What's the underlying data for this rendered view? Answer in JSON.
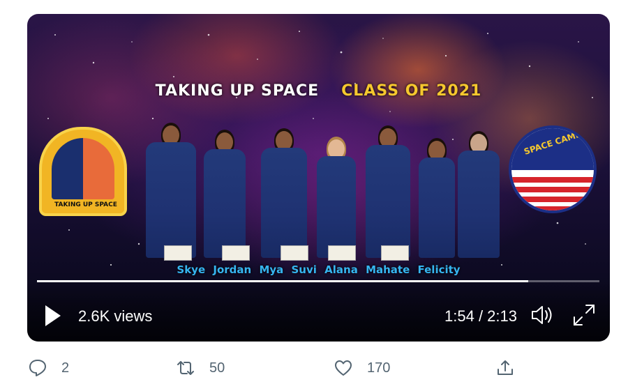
{
  "video": {
    "title_part1": "TAKING UP SPACE",
    "title_part2": "CLASS OF 2021",
    "patch_left_label": "TAKING UP SPACE",
    "patch_right_label": "SPACE CAMP",
    "names": [
      "Skye",
      "Jordan",
      "Mya",
      "Suvi",
      "Alana",
      "Mahate",
      "Felicity"
    ],
    "progress": 0.874,
    "views": "2.6K views",
    "time": "1:54 / 2:13"
  },
  "actions": {
    "reply_count": "2",
    "retweet_count": "50",
    "like_count": "170"
  },
  "icons": {
    "play": "play-icon",
    "volume": "volume-icon",
    "fullscreen": "fullscreen-icon",
    "reply": "reply-icon",
    "retweet": "retweet-icon",
    "like": "heart-icon",
    "share": "share-icon"
  },
  "colors": {
    "title_white": "#ffffff",
    "title_gold": "#f6c82e",
    "names_blue": "#36b5f0",
    "action_gray": "#536471"
  }
}
